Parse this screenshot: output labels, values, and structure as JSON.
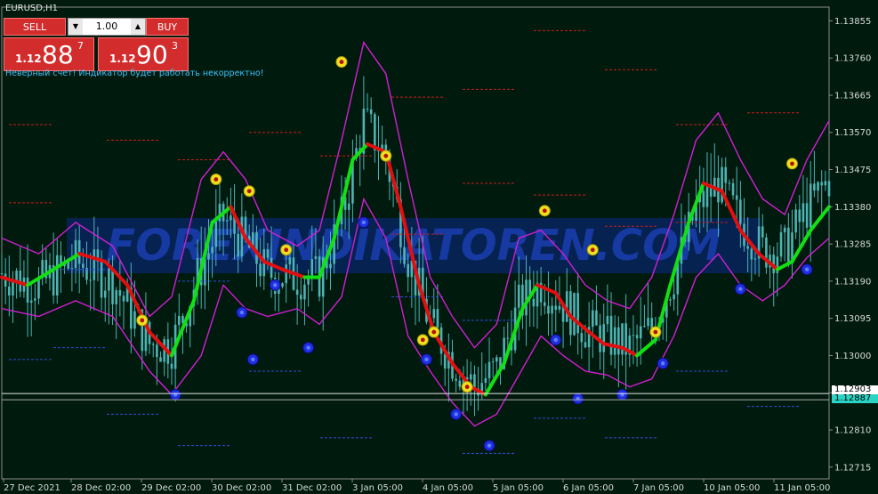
{
  "symbol_title": "EURUSD,H1",
  "trade_panel": {
    "sell_label": "SELL",
    "buy_label": "BUY",
    "lot_value": "1.00",
    "sell_price_prefix": "1.12",
    "sell_price_main": "88",
    "sell_price_sup": "7",
    "buy_price_prefix": "1.12",
    "buy_price_main": "90",
    "buy_price_sup": "3",
    "down_arrow": "▼",
    "up_arrow": "▲"
  },
  "warning_text": "Неверный счет! Индикатор будет работать некорректно!",
  "watermark": "FOREXINDIKATOREN.COM",
  "colors": {
    "background": "#001a0d",
    "candles": "#4fb3b3",
    "bands": "#d21fd2",
    "trend_up": "#12e012",
    "trend_down": "#e01010",
    "levels_red": "#c81e1e",
    "levels_blue": "#2d4fd8",
    "buy_signal": "#f0e020",
    "sell_signal": "#1f2fe0"
  },
  "chart_data": {
    "type": "line",
    "title": "",
    "xlabel": "",
    "ylabel": "",
    "x_ticks": [
      "27 Dec 2021",
      "28 Dec 02:00",
      "29 Dec 02:00",
      "30 Dec 02:00",
      "31 Dec 02:00",
      "3 Jan 05:00",
      "4 Jan 05:00",
      "5 Jan 05:00",
      "6 Jan 05:00",
      "7 Jan 05:00",
      "10 Jan 05:00",
      "11 Jan 05:00"
    ],
    "y_ticks": [
      "1.13855",
      "1.13760",
      "1.13665",
      "1.13570",
      "1.13475",
      "1.13380",
      "1.13285",
      "1.13190",
      "1.13095",
      "1.13000",
      "1.12905",
      "1.12810",
      "1.12715"
    ],
    "ylim": [
      1.12685,
      1.1389
    ],
    "current_bid": "1.12887",
    "current_ask": "1.12903",
    "trend_line": [
      [
        0,
        1.132
      ],
      [
        7,
        1.1318
      ],
      [
        14,
        1.1322
      ],
      [
        21,
        1.1326
      ],
      [
        28,
        1.1324
      ],
      [
        34,
        1.1318
      ],
      [
        40,
        1.1306
      ],
      [
        46,
        1.13
      ],
      [
        52,
        1.1314
      ],
      [
        57,
        1.1334
      ],
      [
        62,
        1.1338
      ],
      [
        66,
        1.133
      ],
      [
        71,
        1.1324
      ],
      [
        76,
        1.1322
      ],
      [
        82,
        1.132
      ],
      [
        86,
        1.132
      ],
      [
        90,
        1.133
      ],
      [
        95,
        1.135
      ],
      [
        99,
        1.1354
      ],
      [
        104,
        1.1352
      ],
      [
        108,
        1.1338
      ],
      [
        113,
        1.1318
      ],
      [
        117,
        1.1306
      ],
      [
        122,
        1.1298
      ],
      [
        127,
        1.1292
      ],
      [
        131,
        1.129
      ],
      [
        136,
        1.1298
      ],
      [
        141,
        1.1312
      ],
      [
        145,
        1.1318
      ],
      [
        150,
        1.1316
      ],
      [
        154,
        1.131
      ],
      [
        159,
        1.1306
      ],
      [
        163,
        1.1303
      ],
      [
        168,
        1.1302
      ],
      [
        172,
        1.13
      ],
      [
        177,
        1.1304
      ],
      [
        181,
        1.1318
      ],
      [
        186,
        1.1334
      ],
      [
        190,
        1.1344
      ],
      [
        195,
        1.1342
      ],
      [
        200,
        1.1332
      ],
      [
        205,
        1.1326
      ],
      [
        210,
        1.1322
      ],
      [
        214,
        1.1324
      ],
      [
        219,
        1.1332
      ],
      [
        224,
        1.1338
      ]
    ],
    "series": [
      {
        "values": [
          [
            0,
            1.133
          ],
          [
            10,
            1.1326
          ],
          [
            20,
            1.1334
          ],
          [
            30,
            1.1328
          ],
          [
            40,
            1.131
          ],
          [
            46,
            1.1315
          ],
          [
            54,
            1.1345
          ],
          [
            60,
            1.1352
          ],
          [
            66,
            1.1345
          ],
          [
            72,
            1.1332
          ],
          [
            80,
            1.1328
          ],
          [
            86,
            1.1332
          ],
          [
            92,
            1.1355
          ],
          [
            98,
            1.138
          ],
          [
            104,
            1.1372
          ],
          [
            110,
            1.1345
          ],
          [
            116,
            1.132
          ],
          [
            122,
            1.131
          ],
          [
            128,
            1.1302
          ],
          [
            134,
            1.1308
          ],
          [
            140,
            1.133
          ],
          [
            146,
            1.1332
          ],
          [
            152,
            1.1326
          ],
          [
            158,
            1.1318
          ],
          [
            164,
            1.1314
          ],
          [
            170,
            1.1312
          ],
          [
            176,
            1.132
          ],
          [
            182,
            1.1336
          ],
          [
            188,
            1.1355
          ],
          [
            194,
            1.1362
          ],
          [
            200,
            1.135
          ],
          [
            206,
            1.134
          ],
          [
            212,
            1.1336
          ],
          [
            218,
            1.135
          ],
          [
            224,
            1.136
          ]
        ]
      },
      {
        "values": [
          [
            0,
            1.1312
          ],
          [
            10,
            1.131
          ],
          [
            20,
            1.1314
          ],
          [
            30,
            1.131
          ],
          [
            40,
            1.1296
          ],
          [
            46,
            1.129
          ],
          [
            54,
            1.13
          ],
          [
            60,
            1.1318
          ],
          [
            66,
            1.1312
          ],
          [
            72,
            1.131
          ],
          [
            80,
            1.1312
          ],
          [
            86,
            1.1308
          ],
          [
            92,
            1.1315
          ],
          [
            98,
            1.134
          ],
          [
            104,
            1.133
          ],
          [
            110,
            1.1305
          ],
          [
            116,
            1.1296
          ],
          [
            122,
            1.1288
          ],
          [
            128,
            1.1282
          ],
          [
            134,
            1.1285
          ],
          [
            140,
            1.1295
          ],
          [
            146,
            1.1305
          ],
          [
            152,
            1.13
          ],
          [
            158,
            1.1296
          ],
          [
            164,
            1.1295
          ],
          [
            170,
            1.1292
          ],
          [
            176,
            1.1294
          ],
          [
            182,
            1.1305
          ],
          [
            188,
            1.132
          ],
          [
            194,
            1.1326
          ],
          [
            200,
            1.1318
          ],
          [
            206,
            1.1314
          ],
          [
            212,
            1.1318
          ],
          [
            218,
            1.1325
          ],
          [
            224,
            1.133
          ]
        ]
      }
    ],
    "buy_signals": [
      [
        38,
        1.1309
      ],
      [
        58,
        1.1345
      ],
      [
        67,
        1.1342
      ],
      [
        77,
        1.1327
      ],
      [
        92,
        1.1375
      ],
      [
        104,
        1.1351
      ],
      [
        114,
        1.1304
      ],
      [
        117,
        1.1306
      ],
      [
        126,
        1.1292
      ],
      [
        147,
        1.1337
      ],
      [
        160,
        1.1327
      ],
      [
        177,
        1.1306
      ],
      [
        214,
        1.1349
      ]
    ],
    "sell_signals": [
      [
        47,
        1.129
      ],
      [
        65,
        1.1311
      ],
      [
        68,
        1.1299
      ],
      [
        74,
        1.1318
      ],
      [
        83,
        1.1302
      ],
      [
        98,
        1.1334
      ],
      [
        115,
        1.1299
      ],
      [
        123,
        1.1285
      ],
      [
        132,
        1.1277
      ],
      [
        150,
        1.1304
      ],
      [
        156,
        1.1289
      ],
      [
        168,
        1.129
      ],
      [
        179,
        1.1298
      ],
      [
        200,
        1.1317
      ],
      [
        218,
        1.1322
      ]
    ]
  }
}
